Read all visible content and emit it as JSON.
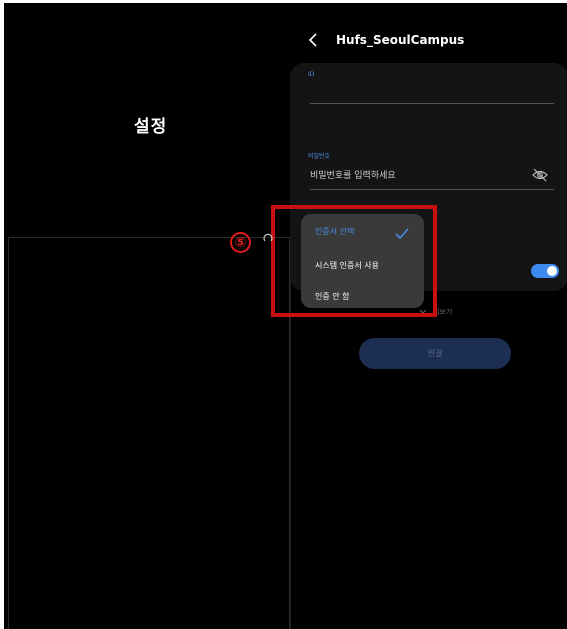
{
  "left_panel": {
    "title": "설정"
  },
  "header": {
    "back_icon": "chevron-left-icon",
    "title": "Hufs_SeoulCampus"
  },
  "form": {
    "id_label": "ID",
    "id_value": "",
    "password_label": "비밀번호",
    "password_placeholder": "비밀번호를 입력하세요",
    "eye_icon": "eye-off-icon"
  },
  "dropdown": {
    "items": [
      {
        "label": "인증서 선택",
        "selected": true
      },
      {
        "label": "시스템 인증서 사용",
        "selected": false
      },
      {
        "label": "인증 안 함",
        "selected": false
      }
    ],
    "check_icon": "check-icon"
  },
  "toggle": {
    "on": true
  },
  "expand_label": "더보기",
  "connect_label": "연결",
  "annotation": {
    "step": "⑤"
  },
  "colors": {
    "accent": "#4a8de6",
    "toggle": "#3d8bf0",
    "highlight": "#c90f0f",
    "button": "#1c2e52"
  }
}
